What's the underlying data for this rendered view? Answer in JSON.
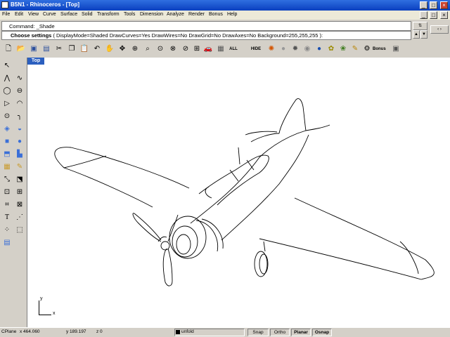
{
  "window": {
    "title": "B5N1 - Rhinoceros - [Top]"
  },
  "menu": [
    "File",
    "Edit",
    "View",
    "Curve",
    "Surface",
    "Solid",
    "Transform",
    "Tools",
    "Dimension",
    "Analyze",
    "Render",
    "Bonus",
    "Help"
  ],
  "command": {
    "history": "Command: _Shade",
    "prompt_label": "Choose settings",
    "prompt_options": "( DisplayMode=Shaded  DrawCurves=Yes  DrawWires=No  DrawGrid=No  DrawAxes=No  Background=255,255,255 ):"
  },
  "toolbar": {
    "icons": [
      "new-icon",
      "open-icon",
      "save-icon",
      "save-small-icon",
      "cut-icon",
      "copy-icon",
      "paste-icon",
      "undo-icon",
      "pan-icon",
      "rotate-view-icon",
      "zoom-icon",
      "zoom-window-icon",
      "zoom-dynamic-icon",
      "zoom-extents-icon",
      "zoom-selected-icon",
      "four-views-icon",
      "car-icon",
      "grid-icon",
      "hide-icon",
      "show-icon",
      "color-wheel-icon",
      "sphere-gray-icon",
      "sphere-dark-icon",
      "sphere-blue-icon",
      "tools-icon",
      "flower-icon",
      "bonus-icon",
      "layer-icon"
    ],
    "show_label": "ALL",
    "hide_label": "HIDE",
    "bonus_label": "Bonus"
  },
  "left_toolbar": {
    "icons": [
      "select-arrow-icon",
      "point-icon",
      "polyline-icon",
      "line-icon",
      "circle-icon",
      "arc-icon",
      "ellipse-icon",
      "rectangle-icon",
      "polygon-icon",
      "curve-icon",
      "freeform-icon",
      "fillet-icon",
      "surface-icon",
      "loft-icon",
      "box-icon",
      "sphere-icon",
      "extrude-icon",
      "solid-edit-icon",
      "boolean-icon",
      "mesh-icon",
      "transform-icon",
      "array-icon",
      "move-icon",
      "scale-icon",
      "text-icon",
      "dimension-icon",
      "group-icon",
      "render-icon",
      "analyze-icon",
      "layers-icon"
    ]
  },
  "viewport": {
    "name": "Top",
    "axis_x": "x",
    "axis_y": "y"
  },
  "status": {
    "cplane": "CPlane",
    "x": "x 464.060",
    "y": "y 189.197",
    "z": "z 0",
    "layer": "unfold",
    "snap": "Snap",
    "ortho": "Ortho",
    "planar": "Planar",
    "osnap": "Osnap"
  }
}
